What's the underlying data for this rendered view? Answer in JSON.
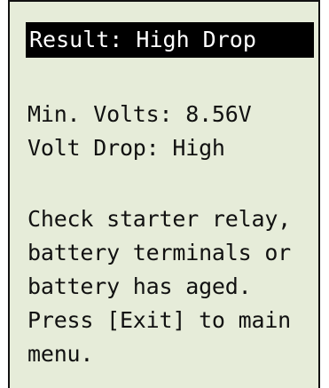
{
  "header": {
    "result_label": "Result: High Drop"
  },
  "readings": {
    "min_volts": "Min. Volts: 8.56V",
    "volt_drop": "Volt Drop: High"
  },
  "message": {
    "lines": [
      "Check starter relay,",
      "battery terminals or",
      "battery has aged.",
      "Press [Exit] to main",
      "menu."
    ]
  },
  "colors": {
    "screen_background": "#e6ecd9",
    "title_background": "#000000",
    "title_text": "#ffffff",
    "text": "#111111"
  }
}
